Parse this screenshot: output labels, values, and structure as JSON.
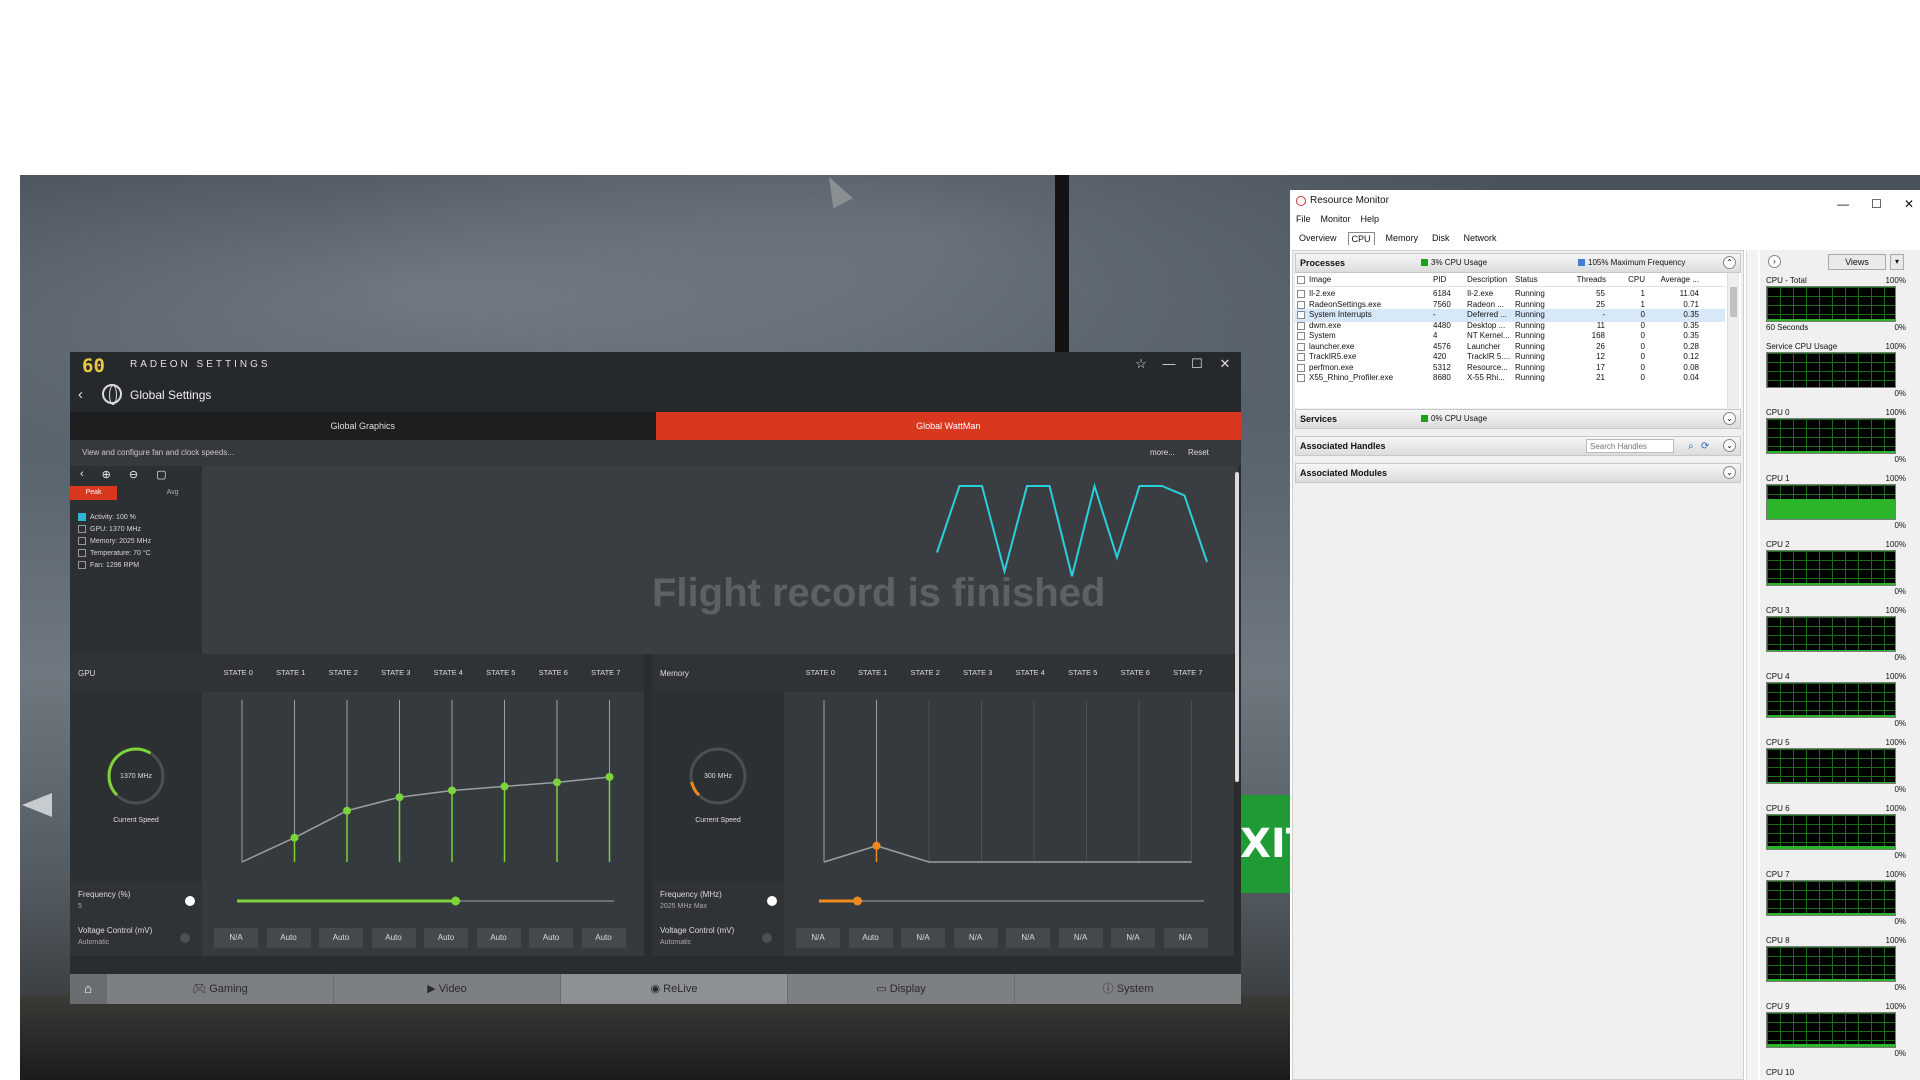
{
  "radeon": {
    "logo": "60",
    "app_name": "RADEON SETTINGS",
    "window_buttons": [
      "☆",
      "—",
      "☐",
      "✕"
    ],
    "page_title": "Global Settings",
    "tabs": [
      {
        "label": "Global Graphics",
        "active": false
      },
      {
        "label": "Global WattMan",
        "active": true
      }
    ],
    "description": "View and configure fan and clock speeds...",
    "more_label": "more...",
    "reset_label": "Reset",
    "peak_label": "Peak",
    "avg_label": "Avg",
    "legend": [
      {
        "label": "Activity: 100 %",
        "checked": true
      },
      {
        "label": "GPU: 1370 MHz",
        "checked": false
      },
      {
        "label": "Memory: 2025 MHz",
        "checked": false
      },
      {
        "label": "Temperature: 70 °C",
        "checked": false
      },
      {
        "label": "Fan: 1296 RPM",
        "checked": false
      }
    ],
    "activity_trace": [
      30,
      100,
      100,
      10,
      100,
      100,
      5,
      100,
      25,
      100,
      100,
      90,
      20
    ],
    "overlay_text": "Flight record is finished",
    "gpu": {
      "label": "GPU",
      "states": [
        "STATE 0",
        "STATE 1",
        "STATE 2",
        "STATE 3",
        "STATE 4",
        "STATE 5",
        "STATE 6",
        "STATE 7"
      ],
      "curve": [
        0,
        18,
        38,
        48,
        53,
        56,
        59,
        63
      ],
      "speed": "1370 MHz",
      "speed_label": "Current Speed",
      "gauge_fraction": 0.62,
      "frequency_label": "Frequency (%)",
      "frequency_sub": "5",
      "slider_fraction": 0.58,
      "voltage_label": "Voltage Control (mV)",
      "voltage_sub": "Automatic",
      "voltage_values": [
        "N/A",
        "Auto",
        "Auto",
        "Auto",
        "Auto",
        "Auto",
        "Auto",
        "Auto"
      ]
    },
    "memory": {
      "label": "Memory",
      "states": [
        "STATE 0",
        "STATE 1",
        "STATE 2",
        "STATE 3",
        "STATE 4",
        "STATE 5",
        "STATE 6",
        "STATE 7"
      ],
      "curve": [
        0,
        12,
        0,
        0,
        0,
        0,
        0,
        0
      ],
      "speed": "300 MHz",
      "speed_label": "Current Speed",
      "gauge_fraction": 0.12,
      "frequency_label": "Frequency (MHz)",
      "frequency_sub": "2025 MHz Max",
      "slider_fraction": 0.1,
      "voltage_label": "Voltage Control (mV)",
      "voltage_sub": "Automatic",
      "voltage_values": [
        "N/A",
        "Auto",
        "N/A",
        "N/A",
        "N/A",
        "N/A",
        "N/A",
        "N/A"
      ]
    },
    "bottom_nav": [
      {
        "label": "Gaming",
        "icon": "gamepad-icon"
      },
      {
        "label": "Video",
        "icon": "play-icon"
      },
      {
        "label": "ReLive",
        "icon": "relive-icon"
      },
      {
        "label": "Display",
        "icon": "monitor-icon"
      },
      {
        "label": "System",
        "icon": "info-icon"
      }
    ],
    "colors": {
      "accent": "#d9371e",
      "gpu_curve": "#7dd33a",
      "mem_curve": "#f08a1c",
      "activity": "#2ad0dc"
    }
  },
  "scene": {
    "exit_text": "XIT"
  },
  "resmon": {
    "title": "Resource Monitor",
    "menu": [
      "File",
      "Monitor",
      "Help"
    ],
    "tabs": [
      "Overview",
      "CPU",
      "Memory",
      "Disk",
      "Network"
    ],
    "active_tab": "CPU",
    "processes": {
      "title": "Processes",
      "usage": "3% CPU Usage",
      "freq": "105% Maximum Frequency",
      "columns": [
        "Image",
        "PID",
        "Description",
        "Status",
        "Threads",
        "CPU",
        "Average ..."
      ],
      "rows": [
        [
          "Il-2.exe",
          "6184",
          "Il-2.exe",
          "Running",
          "55",
          "1",
          "11.04"
        ],
        [
          "RadeonSettings.exe",
          "7560",
          "Radeon ...",
          "Running",
          "25",
          "1",
          "0.71"
        ],
        [
          "System Interrupts",
          "-",
          "Deferred ...",
          "Running",
          "-",
          "0",
          "0.35"
        ],
        [
          "dwm.exe",
          "4480",
          "Desktop ...",
          "Running",
          "11",
          "0",
          "0.35"
        ],
        [
          "System",
          "4",
          "NT Kernel...",
          "Running",
          "168",
          "0",
          "0.35"
        ],
        [
          "launcher.exe",
          "4576",
          "Launcher",
          "Running",
          "26",
          "0",
          "0.28"
        ],
        [
          "TrackIR5.exe",
          "420",
          "TrackIR 5....",
          "Running",
          "12",
          "0",
          "0.12"
        ],
        [
          "perfmon.exe",
          "5312",
          "Resource...",
          "Running",
          "17",
          "0",
          "0.08"
        ],
        [
          "X55_Rhino_Profiler.exe",
          "8680",
          "X-55 Rhi...",
          "Running",
          "21",
          "0",
          "0.04"
        ]
      ]
    },
    "services": {
      "title": "Services",
      "usage": "0% CPU Usage"
    },
    "handles": {
      "title": "Associated Handles",
      "search_placeholder": "Search Handles"
    },
    "modules": {
      "title": "Associated Modules"
    },
    "views_label": "Views",
    "graphs": [
      {
        "title": "CPU - Total",
        "max": "100%",
        "sub": "60 Seconds",
        "min": "0%",
        "level": 0.06
      },
      {
        "title": "Service CPU Usage",
        "max": "100%",
        "sub": "",
        "min": "0%",
        "level": 0.01
      },
      {
        "title": "CPU 0",
        "max": "100%",
        "sub": "",
        "min": "0%",
        "level": 0.05
      },
      {
        "title": "CPU 1",
        "max": "100%",
        "sub": "",
        "min": "0%",
        "level": 0.6
      },
      {
        "title": "CPU 2",
        "max": "100%",
        "sub": "",
        "min": "0%",
        "level": 0.05
      },
      {
        "title": "CPU 3",
        "max": "100%",
        "sub": "",
        "min": "0%",
        "level": 0.04
      },
      {
        "title": "CPU 4",
        "max": "100%",
        "sub": "",
        "min": "0%",
        "level": 0.05
      },
      {
        "title": "CPU 5",
        "max": "100%",
        "sub": "",
        "min": "0%",
        "level": 0.04
      },
      {
        "title": "CPU 6",
        "max": "100%",
        "sub": "",
        "min": "0%",
        "level": 0.08
      },
      {
        "title": "CPU 7",
        "max": "100%",
        "sub": "",
        "min": "0%",
        "level": 0.05
      },
      {
        "title": "CPU 8",
        "max": "100%",
        "sub": "",
        "min": "0%",
        "level": 0.06
      },
      {
        "title": "CPU 9",
        "max": "100%",
        "sub": "",
        "min": "0%",
        "level": 0.1
      },
      {
        "title": "CPU 10",
        "max": "",
        "sub": "",
        "min": "",
        "level": 0
      }
    ]
  }
}
